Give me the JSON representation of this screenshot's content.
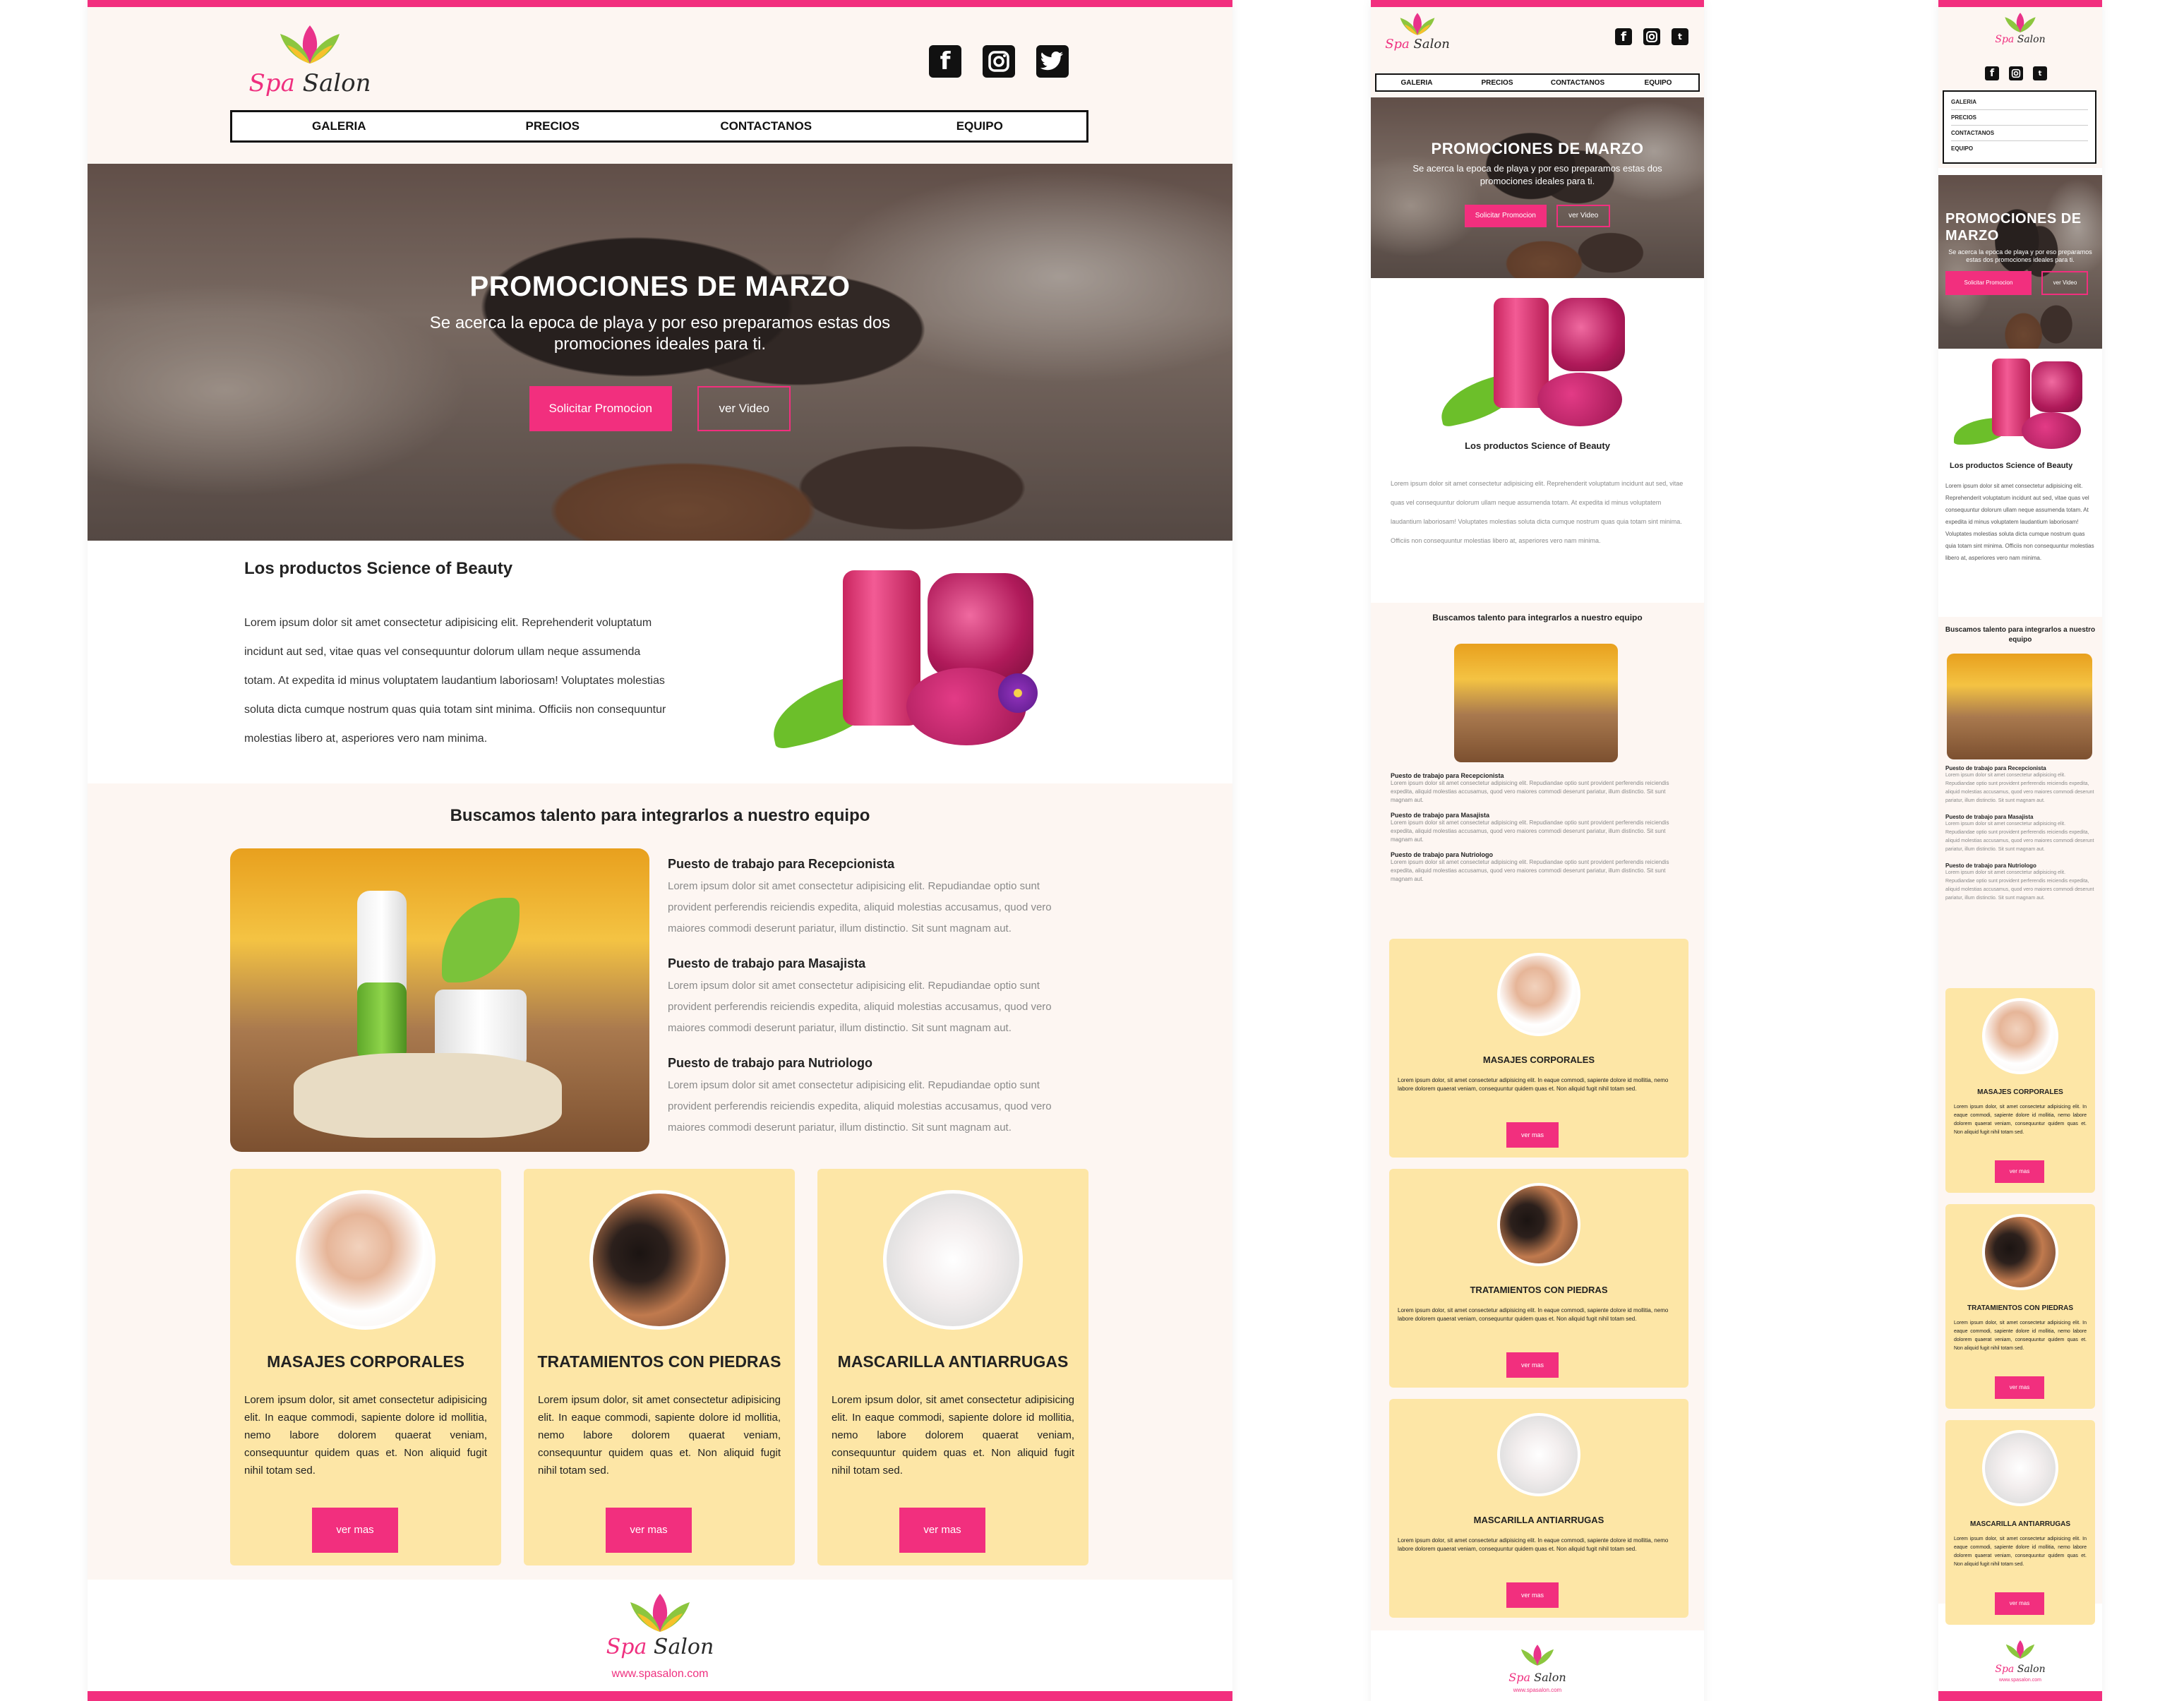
{
  "brand": {
    "word1": "Spa",
    "word2": "Salon",
    "website": "www.spasalon.com"
  },
  "social": {
    "facebook_icon": "facebook-icon",
    "instagram_icon": "instagram-icon",
    "twitter_icon": "twitter-icon"
  },
  "nav": {
    "items": [
      "GALERIA",
      "PRECIOS",
      "CONTACTANOS",
      "EQUIPO"
    ]
  },
  "hero": {
    "title": "PROMOCIONES DE MARZO",
    "subtitle": "Se acerca la epoca de playa y por eso preparamos estas dos promociones ideales para ti.",
    "primary_button": "Solicitar Promocion",
    "secondary_button": "ver Video"
  },
  "products": {
    "title": "Los productos Science of Beauty",
    "body": "Lorem ipsum dolor sit amet consectetur adipisicing elit. Reprehenderit voluptatum incidunt aut sed, vitae quas vel consequuntur dolorum ullam neque assumenda totam. At expedita id minus voluptatem laudantium laboriosam! Voluptates molestias soluta dicta cumque nostrum quas quia totam sint minima. Officiis non consequuntur molestias libero at, asperiores vero nam minima."
  },
  "jobs": {
    "title": "Buscamos talento para integrarlos a nuestro equipo",
    "items": [
      {
        "title": "Puesto de trabajo para Recepcionista",
        "body": "Lorem ipsum dolor sit amet consectetur adipisicing elit. Repudiandae optio sunt provident perferendis reiciendis expedita, aliquid molestias accusamus, quod vero maiores commodi deserunt pariatur, illum distinctio. Sit sunt magnam aut."
      },
      {
        "title": "Puesto de trabajo para Masajista",
        "body": "Lorem ipsum dolor sit amet consectetur adipisicing elit. Repudiandae optio sunt provident perferendis reiciendis expedita, aliquid molestias accusamus, quod vero maiores commodi deserunt pariatur, illum distinctio. Sit sunt magnam aut."
      },
      {
        "title": "Puesto de trabajo para Nutriologo",
        "body": "Lorem ipsum dolor sit amet consectetur adipisicing elit. Repudiandae optio sunt provident perferendis reiciendis expedita, aliquid molestias accusamus, quod vero maiores commodi deserunt pariatur, illum distinctio. Sit sunt magnam aut."
      }
    ]
  },
  "services": {
    "items": [
      {
        "title": "MASAJES CORPORALES",
        "body": "Lorem ipsum dolor, sit amet consectetur adipisicing elit. In eaque commodi, sapiente dolore id mollitia, nemo labore dolorem quaerat veniam, consequuntur quidem quas et. Non aliquid fugit nihil totam sed.",
        "button": "ver mas"
      },
      {
        "title": "TRATAMIENTOS CON PIEDRAS",
        "body": "Lorem ipsum dolor, sit amet consectetur adipisicing elit. In eaque commodi, sapiente dolore id mollitia, nemo labore dolorem quaerat veniam, consequuntur quidem quas et. Non aliquid fugit nihil totam sed.",
        "button": "ver mas"
      },
      {
        "title": "MASCARILLA ANTIARRUGAS",
        "body": "Lorem ipsum dolor, sit amet consectetur adipisicing elit. In eaque commodi, sapiente dolore id mollitia, nemo labore dolorem quaerat veniam, consequuntur quidem quas et. Non aliquid fugit nihil totam sed.",
        "button": "ver mas"
      }
    ]
  },
  "colors": {
    "accent": "#f22f7e",
    "cream": "#fdf6f2",
    "card": "#fde6a6",
    "text": "#222222"
  }
}
